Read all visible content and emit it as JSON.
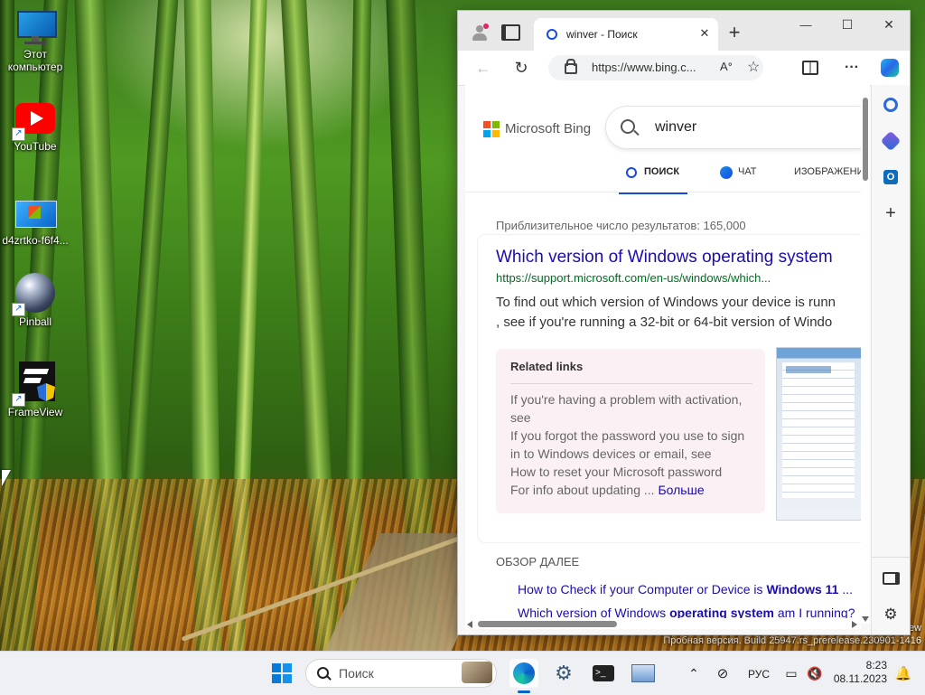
{
  "desktop": {
    "icons": [
      {
        "label": "Этот компьютер",
        "icon": "computer-icon"
      },
      {
        "label": "YouTube",
        "icon": "youtube-icon"
      },
      {
        "label": "d4zrtko-f6f4...",
        "icon": "image-file-icon"
      },
      {
        "label": "Pinball",
        "icon": "pinball-icon"
      },
      {
        "label": "FrameView",
        "icon": "frameview-icon"
      }
    ],
    "watermark_line1": "ew",
    "watermark_line2": "Пробная версия. Build 25947.rs_prerelease.230901-1416"
  },
  "browser": {
    "tab_title": "winver - Поиск",
    "url": "https://www.bing.c...",
    "window_buttons": {
      "minimize": "—",
      "maximize": "☐",
      "close": "✕"
    },
    "new_tab": "+"
  },
  "bing": {
    "logo_text": "Microsoft Bing",
    "query": "winver",
    "tabs": [
      {
        "label": "ПОИСК",
        "active": true
      },
      {
        "label": "ЧАТ",
        "active": false
      },
      {
        "label": "ИЗОБРАЖЕНИ",
        "active": false
      }
    ],
    "result_count": "Приблизительное число результатов: 165,000",
    "result": {
      "title": "Which version of Windows operating system",
      "url": "https://support.microsoft.com/en-us/windows/which...",
      "snippet1": "To find out which version of Windows your device is runn",
      "snippet2": ", see if you're running a 32-bit or 64-bit version of Windo"
    },
    "related": {
      "heading": "Related links",
      "items": [
        "If you're having a problem with activation,",
        "see",
        "If you forgot the password you use to sign",
        "in to Windows devices or email, see",
        "How to reset your Microsoft password",
        "For info about updating ..."
      ],
      "more": "Больше"
    },
    "more_section": {
      "heading": "ОБЗОР ДАЛЕЕ",
      "link1_pre": "How to Check if your Computer or Device is ",
      "link1_bold": "Windows 11",
      "link1_post": " ...",
      "link2_pre": "Which version of Windows ",
      "link2_bold": "operating system",
      "link2_post": " am I running?"
    }
  },
  "taskbar": {
    "search_placeholder": "Поиск",
    "language": "РУС",
    "time": "8:23",
    "date": "08.11.2023"
  },
  "colors": {
    "bing_link": "#1a0dab",
    "bing_tab_active": "#174ae4",
    "related_bg": "#fbf1f5"
  }
}
